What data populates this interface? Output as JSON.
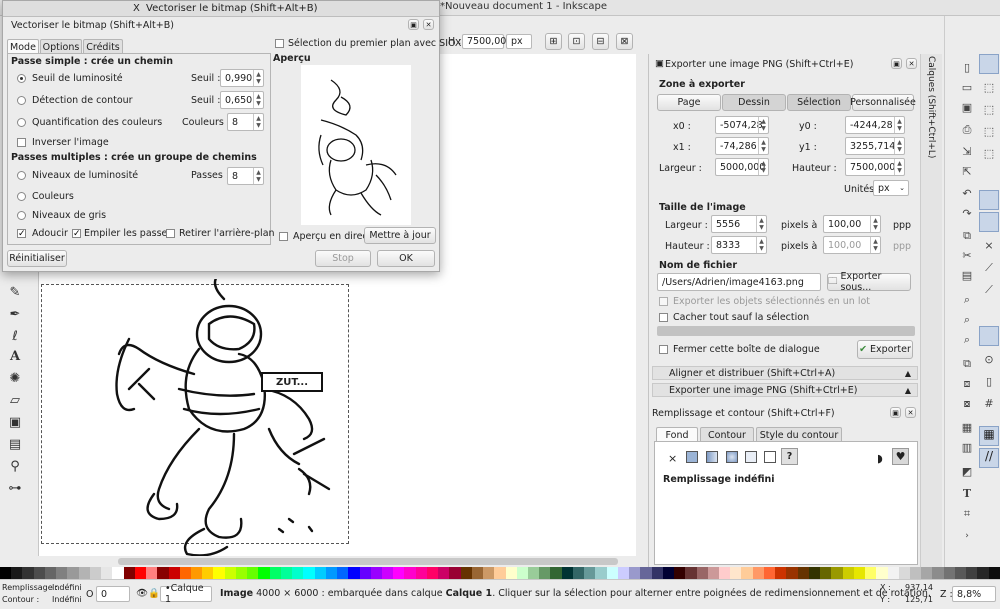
{
  "window": {
    "title": "*Nouveau document 1 - Inkscape"
  },
  "toolbar": {
    "h_label": "H :",
    "h_value": "7500,00",
    "unit": "px"
  },
  "trace": {
    "title": "Vectoriser le bitmap (Shift+Alt+B)",
    "subtitle": "Vectoriser le bitmap (Shift+Alt+B)",
    "tabs": [
      "Mode",
      "Options",
      "Crédits"
    ],
    "single_header": "Passe simple : crée un chemin",
    "brightness": "Seuil de luminosité",
    "edge": "Détection de contour",
    "quant": "Quantification des couleurs",
    "seuil_label": "Seuil :",
    "seuil1": "0,990",
    "seuil2": "0,650",
    "couleurs_label": "Couleurs :",
    "couleurs_val": "8",
    "invert": "Inverser l'image",
    "multi_header": "Passes multiples : crée un groupe de chemins",
    "levels": "Niveaux de luminosité",
    "passes_label": "Passes :",
    "passes_val": "8",
    "colors": "Couleurs",
    "grays": "Niveaux de gris",
    "smooth": "Adoucir",
    "stack": "Empiler les passes",
    "remove_bg": "Retirer l'arrière-plan",
    "siox": "Sélection du premier plan avec SIOX",
    "preview": "Aperçu",
    "live": "Aperçu en direct",
    "update": "Mettre à jour",
    "reset": "Réinitialiser",
    "stop": "Stop",
    "ok": "OK"
  },
  "export": {
    "title": "Exporter une image PNG (Shift+Ctrl+E)",
    "area": "Zone à exporter",
    "area_tabs": [
      "Page",
      "Dessin",
      "Sélection",
      "Personnalisée"
    ],
    "x0_label": "x0 :",
    "x0": "-5074,28",
    "y0_label": "y0 :",
    "y0": "-4244,28",
    "x1_label": "x1 :",
    "x1": "-74,286",
    "y1_label": "y1 :",
    "y1": "3255,714",
    "w_label": "Largeur :",
    "w": "5000,000",
    "h_label": "Hauteur :",
    "h": "7500,000",
    "units_label": "Unités :",
    "units": "px",
    "img_size": "Taille de l'image",
    "iw_label": "Largeur :",
    "iw": "5556",
    "px_at": "pixels à",
    "dpi1": "100,00",
    "ppp": "ppp",
    "ih_label": "Hauteur :",
    "ih": "8333",
    "dpi2": "100,00",
    "filename_label": "Nom de fichier",
    "filename": "/Users/Adrien/image4163.png",
    "export_as": "Exporter sous...",
    "export_sel": "Exporter les objets sélectionnés en un lot",
    "hide_all": "Cacher tout sauf la sélection",
    "close_after": "Fermer cette boîte de dialogue",
    "export_btn": "Exporter"
  },
  "align_panel": "Aligner et distribuer (Shift+Ctrl+A)",
  "export_collapsed": "Exporter une image PNG (Shift+Ctrl+E)",
  "fill": {
    "title": "Remplissage et contour (Shift+Ctrl+F)",
    "tabs": [
      "Fond",
      "Contour",
      "Style du contour"
    ],
    "x": "×",
    "q": "?",
    "undefined": "Remplissage indéfini"
  },
  "layers_tab": "Calques (Shift+Ctrl+L)",
  "canvas": {
    "bubble": "ZUT..."
  },
  "status": {
    "fill_label": "Remplissage :",
    "fill_val": "Indéfini",
    "stroke_label": "Contour :",
    "stroke_val": "Indéfini",
    "opacity_label": "O :",
    "opacity_val": "0",
    "layer": "•Calque 1",
    "msg_bold": "Image",
    "msg": " 4000 × 6000 : embarquée dans calque ",
    "msg_layer": "Calque 1",
    "msg_rest": ". Cliquer sur la sélection pour alterner entre poignées de redimensionnement et de rotation.",
    "x_label": "X :",
    "x": "937,14",
    "y_label": "Y :",
    "y": "125,71",
    "z_label": "Z :",
    "zoom": "8,8%"
  }
}
